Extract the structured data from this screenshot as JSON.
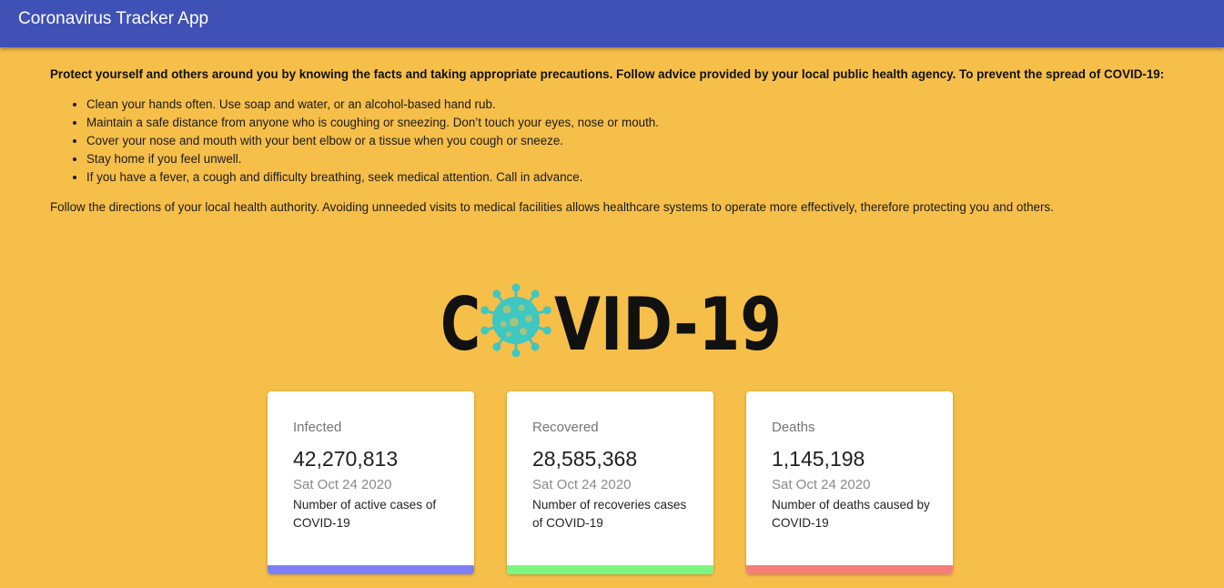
{
  "appbar": {
    "title": "Coronavirus Tracker App"
  },
  "intro": "Protect yourself and others around you by knowing the facts and taking appropriate precautions. Follow advice provided by your local public health agency. To prevent the spread of COVID-19:",
  "tips": [
    "Clean your hands often. Use soap and water, or an alcohol-based hand rub.",
    "Maintain a safe distance from anyone who is coughing or sneezing. Don’t touch your eyes, nose or mouth.",
    "Cover your nose and mouth with your bent elbow or a tissue when you cough or sneeze.",
    "Stay home if you feel unwell.",
    "If you have a fever, a cough and difficulty breathing, seek medical attention. Call in advance."
  ],
  "outro": "Follow the directions of your local health authority. Avoiding unneeded visits to medical facilities allows healthcare systems to operate more effectively, therefore protecting you and others.",
  "logo": {
    "text_left": "C",
    "text_right": "VID-19",
    "virus_color": "#3fc7c1",
    "text_color": "#111111"
  },
  "cards": [
    {
      "title": "Infected",
      "value": "42,270,813",
      "date": "Sat Oct 24 2020",
      "desc": "Number of active cases of COVID-19",
      "color": "#7f7ff5"
    },
    {
      "title": "Recovered",
      "value": "28,585,368",
      "date": "Sat Oct 24 2020",
      "desc": "Number of recoveries cases of COVID-19",
      "color": "#7ef57f"
    },
    {
      "title": "Deaths",
      "value": "1,145,198",
      "date": "Sat Oct 24 2020",
      "desc": "Number of deaths caused by COVID-19",
      "color": "#f47f78"
    }
  ]
}
